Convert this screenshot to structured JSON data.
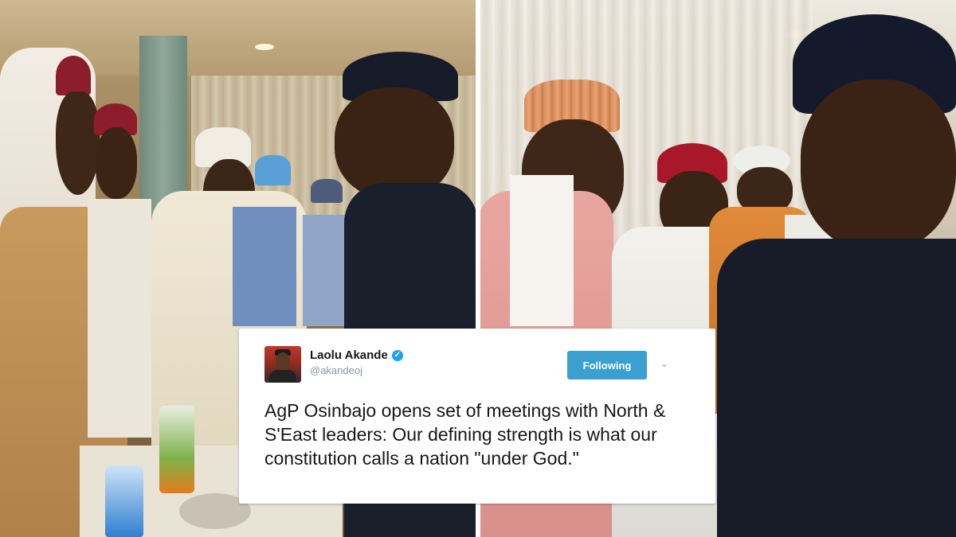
{
  "tweet": {
    "display_name": "Laolu Akande",
    "handle": "@akandeoj",
    "follow_label": "Following",
    "text": "AgP Osinbajo opens set of meetings with North & S'East leaders: Our defining strength is what our constitution calls a nation \"under God.\""
  },
  "photos": {
    "left": {
      "description_icon": "photo"
    },
    "right": {
      "description_icon": "photo"
    }
  },
  "colors": {
    "follow_button": "#3a9fd1",
    "verified": "#1da1f2",
    "card_bg": "#ffffff"
  }
}
